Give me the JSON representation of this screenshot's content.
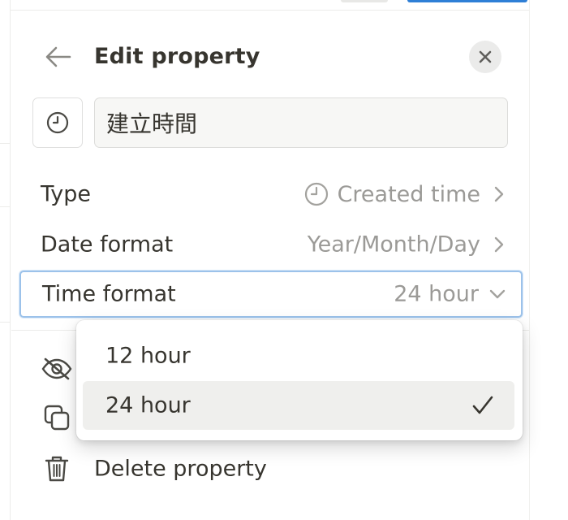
{
  "header": {
    "title": "Edit property",
    "back_icon": "arrow-left-icon",
    "close_icon": "close-icon"
  },
  "name_field": {
    "icon": "clock-icon",
    "value": "建立時間"
  },
  "properties": {
    "type": {
      "label": "Type",
      "value": "Created time",
      "value_icon": "clock-icon"
    },
    "date_format": {
      "label": "Date format",
      "value": "Year/Month/Day"
    },
    "time_format": {
      "label": "Time format",
      "value": "24 hour"
    }
  },
  "actions": {
    "hide": {
      "icon": "eye-off-icon"
    },
    "duplicate": {
      "icon": "duplicate-icon"
    },
    "delete": {
      "icon": "trash-icon",
      "label": "Delete property"
    }
  },
  "time_format_dropdown": {
    "options": [
      {
        "label": "12 hour",
        "selected": false
      },
      {
        "label": "24 hour",
        "selected": true
      }
    ],
    "check_icon": "checkmark-icon"
  },
  "colors": {
    "text": "#37352f",
    "muted": "#9b9a97",
    "focus_ring": "#9cc2ea",
    "accent_blue": "#2e7fd6"
  }
}
